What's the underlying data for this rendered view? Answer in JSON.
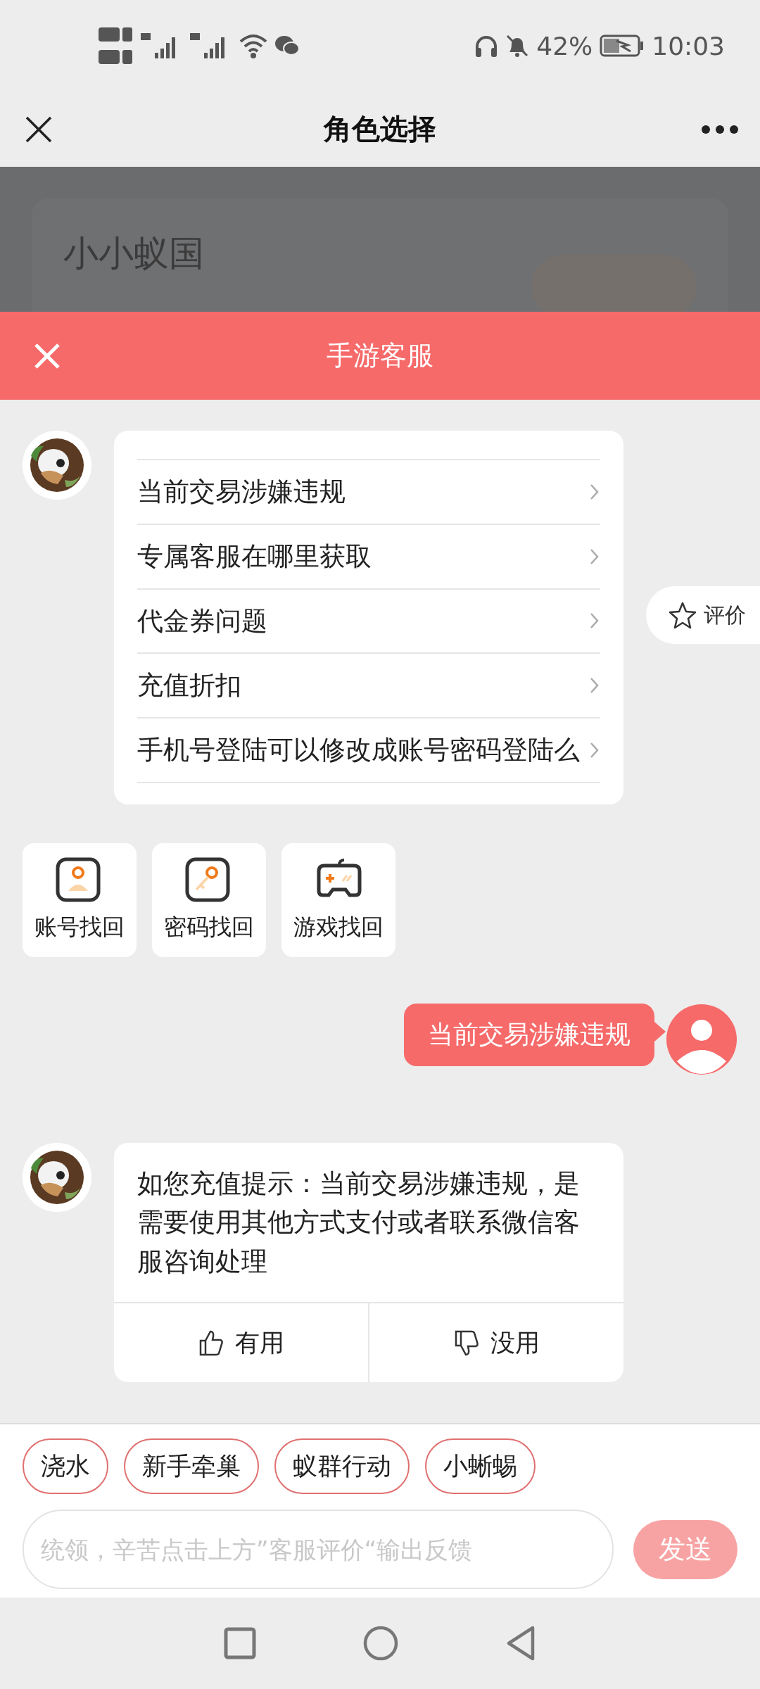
{
  "status_bar": {
    "battery": "42%",
    "time": "10:03"
  },
  "nav": {
    "title": "角色选择"
  },
  "background_card": {
    "title": "小小蚁国"
  },
  "chat_header": {
    "title": "手游客服"
  },
  "rating_button": {
    "label": "评价"
  },
  "messages": [
    {
      "kind": "menu",
      "items": [
        "当前交易涉嫌违规",
        "专属客服在哪里获取",
        "代金券问题",
        "充值折扣",
        "手机号登陆可以修改成账号密码登陆么"
      ]
    },
    {
      "kind": "shortcuts",
      "items": [
        {
          "label": "账号找回",
          "kind": "account"
        },
        {
          "label": "密码找回",
          "kind": "key"
        },
        {
          "label": "游戏找回",
          "kind": "game"
        }
      ]
    },
    {
      "kind": "user",
      "text": "当前交易涉嫌违规"
    },
    {
      "kind": "answer",
      "text": "如您充值提示：当前交易涉嫌违规，是需要使用其他方式支付或者联系微信客服咨询处理",
      "actions": [
        {
          "label": "有用",
          "kind": "up"
        },
        {
          "label": "没用",
          "kind": "down"
        }
      ]
    }
  ],
  "quick_replies": [
    "浇水",
    "新手牵巢",
    "蚁群行动",
    "小蜥蜴"
  ],
  "input": {
    "placeholder": "统领，辛苦点击上方”客服评价“输出反馈"
  },
  "send_button": {
    "label": "发送"
  }
}
